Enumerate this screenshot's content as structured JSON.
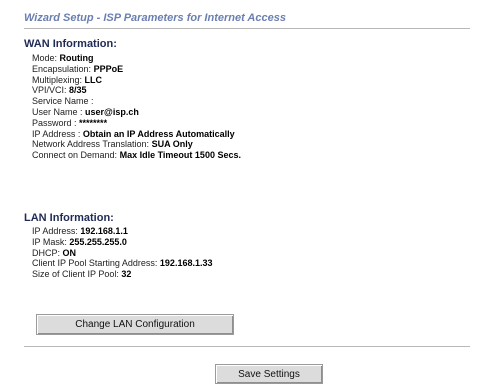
{
  "header": {
    "title": "Wizard Setup - ISP Parameters for Internet Access"
  },
  "wan": {
    "heading": "WAN Information:",
    "rows": [
      {
        "label": "Mode:",
        "value": "Routing"
      },
      {
        "label": "Encapsulation:",
        "value": "PPPoE"
      },
      {
        "label": "Multiplexing:",
        "value": "LLC"
      },
      {
        "label": "VPI/VCI:",
        "value": "8/35"
      },
      {
        "label": "Service Name :",
        "value": ""
      },
      {
        "label": "User Name :",
        "value": "user@isp.ch"
      },
      {
        "label": "Password :",
        "value": "********"
      },
      {
        "label": "IP Address :",
        "value": "Obtain an IP Address Automatically"
      },
      {
        "label": "Network Address Translation:",
        "value": "SUA Only"
      },
      {
        "label": "Connect on Demand:",
        "value": "Max Idle Timeout 1500 Secs."
      }
    ]
  },
  "lan": {
    "heading": "LAN Information:",
    "rows": [
      {
        "label": "IP Address:",
        "value": "192.168.1.1"
      },
      {
        "label": "IP Mask:",
        "value": "255.255.255.0"
      },
      {
        "label": "DHCP:",
        "value": "ON"
      },
      {
        "label": "Client IP Pool Starting Address:",
        "value": "192.168.1.33"
      },
      {
        "label": "Size of Client IP Pool:",
        "value": "32"
      }
    ],
    "change_button_label": "Change LAN Configuration"
  },
  "footer": {
    "save_button_label": "Save Settings"
  }
}
